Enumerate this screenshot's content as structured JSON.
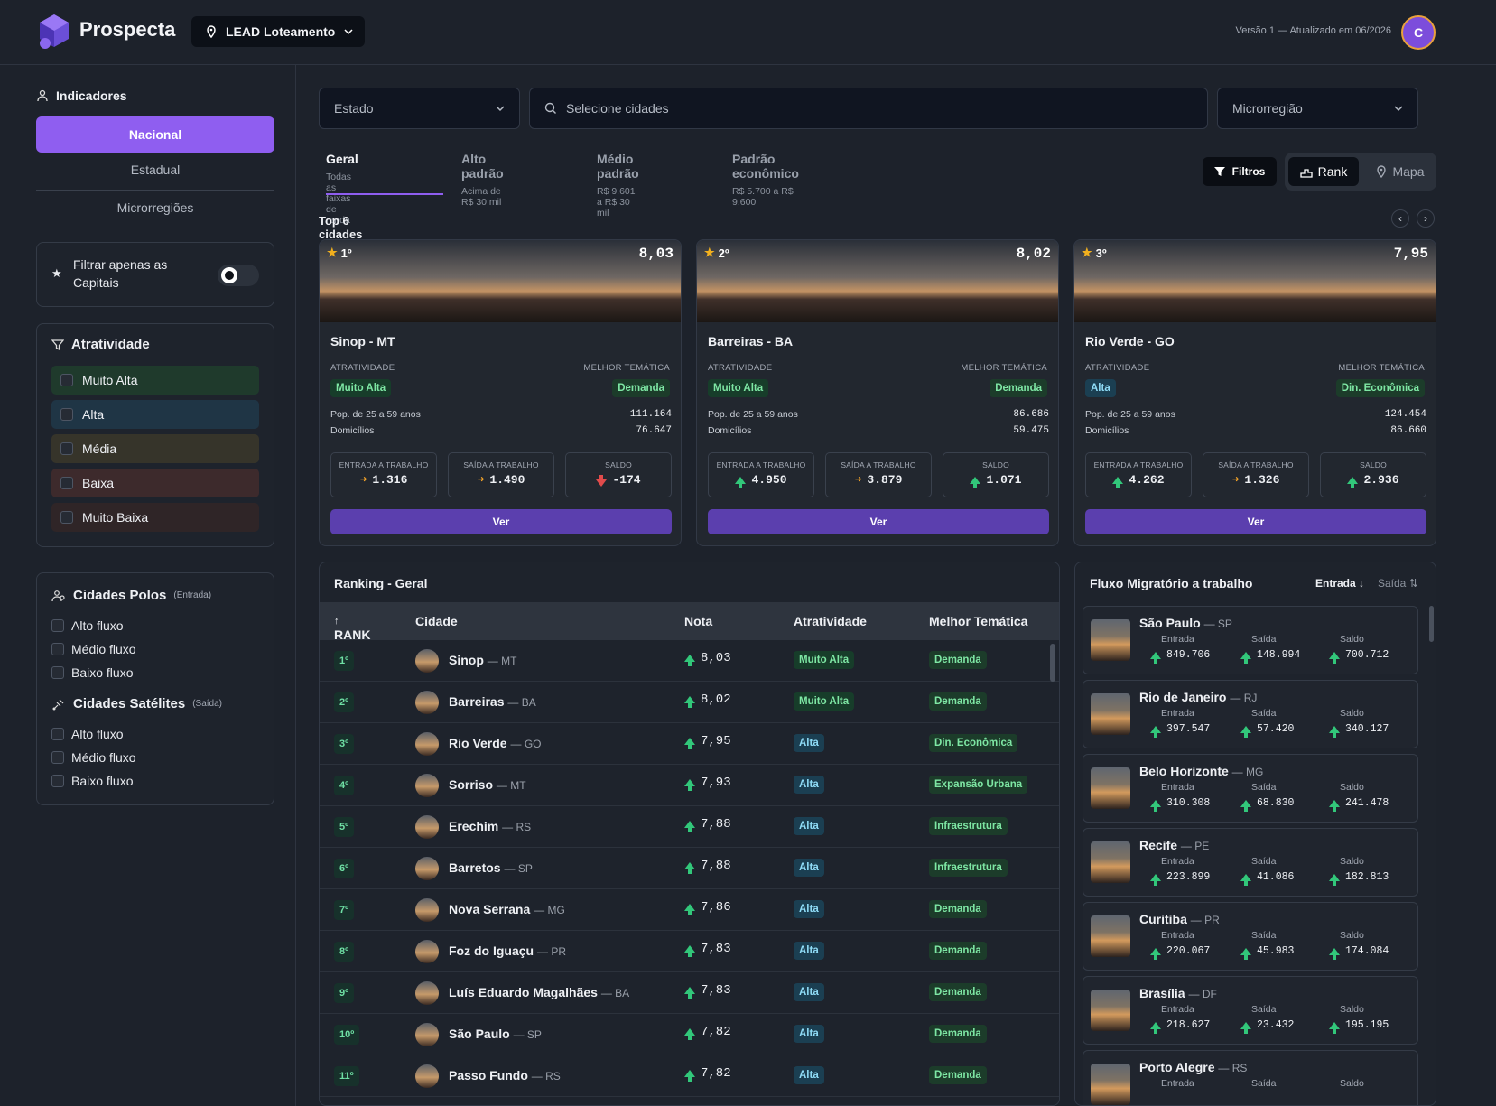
{
  "header": {
    "brand": "Prospecta",
    "project": "LEAD Loteamento",
    "version": "Versão 1 — Atualizado em 06/2026",
    "avatar_initial": "C"
  },
  "sidebar": {
    "title": "Indicadores",
    "levels": [
      "Nacional",
      "Estadual",
      "Microrregiões"
    ],
    "capitals_filter": "Filtrar apenas as Capitais",
    "attractiveness": {
      "title": "Atratividade",
      "options": [
        {
          "label": "Muito Alta",
          "color": "#1f3a2c"
        },
        {
          "label": "Alta",
          "color": "#1f3545"
        },
        {
          "label": "Média",
          "color": "#36342a"
        },
        {
          "label": "Baixa",
          "color": "#3d2a2c"
        },
        {
          "label": "Muito Baixa",
          "color": "#2f2527"
        }
      ]
    },
    "poles": {
      "title": "Cidades Polos",
      "tag": "(Entrada)",
      "options": [
        "Alto fluxo",
        "Médio fluxo",
        "Baixo fluxo"
      ]
    },
    "satellites": {
      "title": "Cidades Satélites",
      "tag": "(Saída)",
      "options": [
        "Alto fluxo",
        "Médio fluxo",
        "Baixo fluxo"
      ]
    }
  },
  "filters": {
    "estado": "Estado",
    "cidades_placeholder": "Selecione cidades",
    "microrregiao": "Microrregião"
  },
  "tabs": [
    {
      "label": "Geral",
      "sub": "Todas as faixas de renda"
    },
    {
      "label": "Alto padrão",
      "sub": "Acima de R$ 30 mil"
    },
    {
      "label": "Médio padrão",
      "sub": "R$ 9.601 a R$ 30 mil"
    },
    {
      "label": "Padrão econômico",
      "sub": "R$ 5.700 a R$ 9.600"
    }
  ],
  "toolbar": {
    "filtros": "Filtros",
    "rank": "Rank",
    "mapa": "Mapa"
  },
  "top": {
    "title": "Top 6 cidades",
    "labels": {
      "atratividade": "ATRATIVIDADE",
      "tematica": "MELHOR TEMÁTICA",
      "pop": "Pop. de 25 a 59 anos",
      "dom": "Domicílios",
      "entrada": "ENTRADA A TRABALHO",
      "saida": "SAÍDA A TRABALHO",
      "saldo": "SALDO",
      "ver": "Ver"
    },
    "cards": [
      {
        "rank": "1º",
        "score": "8,03",
        "city": "Sinop - MT",
        "atr": "Muito Alta",
        "tema": "Demanda",
        "pop": "111.164",
        "dom": "76.647",
        "entrada": "1.316",
        "saida": "1.490",
        "saldo": "-174",
        "entrada_dir": "right",
        "saida_dir": "right",
        "saldo_dir": "down"
      },
      {
        "rank": "2º",
        "score": "8,02",
        "city": "Barreiras - BA",
        "atr": "Muito Alta",
        "tema": "Demanda",
        "pop": "86.686",
        "dom": "59.475",
        "entrada": "4.950",
        "saida": "3.879",
        "saldo": "1.071",
        "entrada_dir": "up",
        "saida_dir": "right",
        "saldo_dir": "up"
      },
      {
        "rank": "3º",
        "score": "7,95",
        "city": "Rio Verde - GO",
        "atr": "Alta",
        "tema": "Din. Econômica",
        "pop": "124.454",
        "dom": "86.660",
        "entrada": "4.262",
        "saida": "1.326",
        "saldo": "2.936",
        "entrada_dir": "up",
        "saida_dir": "right",
        "saldo_dir": "up"
      }
    ]
  },
  "ranking": {
    "title": "Ranking - Geral",
    "headers": {
      "rank": "RANK",
      "cidade": "Cidade",
      "nota": "Nota",
      "atr": "Atratividade",
      "tema": "Melhor Temática"
    },
    "rows": [
      {
        "pos": "1º",
        "city": "Sinop",
        "uf": "— MT",
        "nota": "8,03",
        "atr": "Muito Alta",
        "tema": "Demanda"
      },
      {
        "pos": "2º",
        "city": "Barreiras",
        "uf": "— BA",
        "nota": "8,02",
        "atr": "Muito Alta",
        "tema": "Demanda"
      },
      {
        "pos": "3º",
        "city": "Rio Verde",
        "uf": "— GO",
        "nota": "7,95",
        "atr": "Alta",
        "tema": "Din. Econômica"
      },
      {
        "pos": "4º",
        "city": "Sorriso",
        "uf": "— MT",
        "nota": "7,93",
        "atr": "Alta",
        "tema": "Expansão Urbana"
      },
      {
        "pos": "5º",
        "city": "Erechim",
        "uf": "— RS",
        "nota": "7,88",
        "atr": "Alta",
        "tema": "Infraestrutura"
      },
      {
        "pos": "6º",
        "city": "Barretos",
        "uf": "— SP",
        "nota": "7,88",
        "atr": "Alta",
        "tema": "Infraestrutura"
      },
      {
        "pos": "7º",
        "city": "Nova Serrana",
        "uf": "— MG",
        "nota": "7,86",
        "atr": "Alta",
        "tema": "Demanda"
      },
      {
        "pos": "8º",
        "city": "Foz do Iguaçu",
        "uf": "— PR",
        "nota": "7,83",
        "atr": "Alta",
        "tema": "Demanda"
      },
      {
        "pos": "9º",
        "city": "Luís Eduardo Magalhães",
        "uf": "— BA",
        "nota": "7,83",
        "atr": "Alta",
        "tema": "Demanda"
      },
      {
        "pos": "10º",
        "city": "São Paulo",
        "uf": "— SP",
        "nota": "7,82",
        "atr": "Alta",
        "tema": "Demanda"
      },
      {
        "pos": "11º",
        "city": "Passo Fundo",
        "uf": "— RS",
        "nota": "7,82",
        "atr": "Alta",
        "tema": "Demanda"
      }
    ]
  },
  "flux": {
    "title": "Fluxo Migratório a trabalho",
    "sort_entrada": "Entrada ↓",
    "sort_saida": "Saída ⇅",
    "labels": {
      "entrada": "Entrada",
      "saida": "Saída",
      "saldo": "Saldo"
    },
    "items": [
      {
        "city": "São Paulo",
        "uf": "— SP",
        "entrada": "849.706",
        "saida": "148.994",
        "saldo": "700.712"
      },
      {
        "city": "Rio de Janeiro",
        "uf": "— RJ",
        "entrada": "397.547",
        "saida": "57.420",
        "saldo": "340.127"
      },
      {
        "city": "Belo Horizonte",
        "uf": "— MG",
        "entrada": "310.308",
        "saida": "68.830",
        "saldo": "241.478"
      },
      {
        "city": "Recife",
        "uf": "— PE",
        "entrada": "223.899",
        "saida": "41.086",
        "saldo": "182.813"
      },
      {
        "city": "Curitiba",
        "uf": "— PR",
        "entrada": "220.067",
        "saida": "45.983",
        "saldo": "174.084"
      },
      {
        "city": "Brasília",
        "uf": "— DF",
        "entrada": "218.627",
        "saida": "23.432",
        "saldo": "195.195"
      },
      {
        "city": "Porto Alegre",
        "uf": "— RS",
        "entrada": "",
        "saida": "",
        "saldo": ""
      }
    ]
  }
}
